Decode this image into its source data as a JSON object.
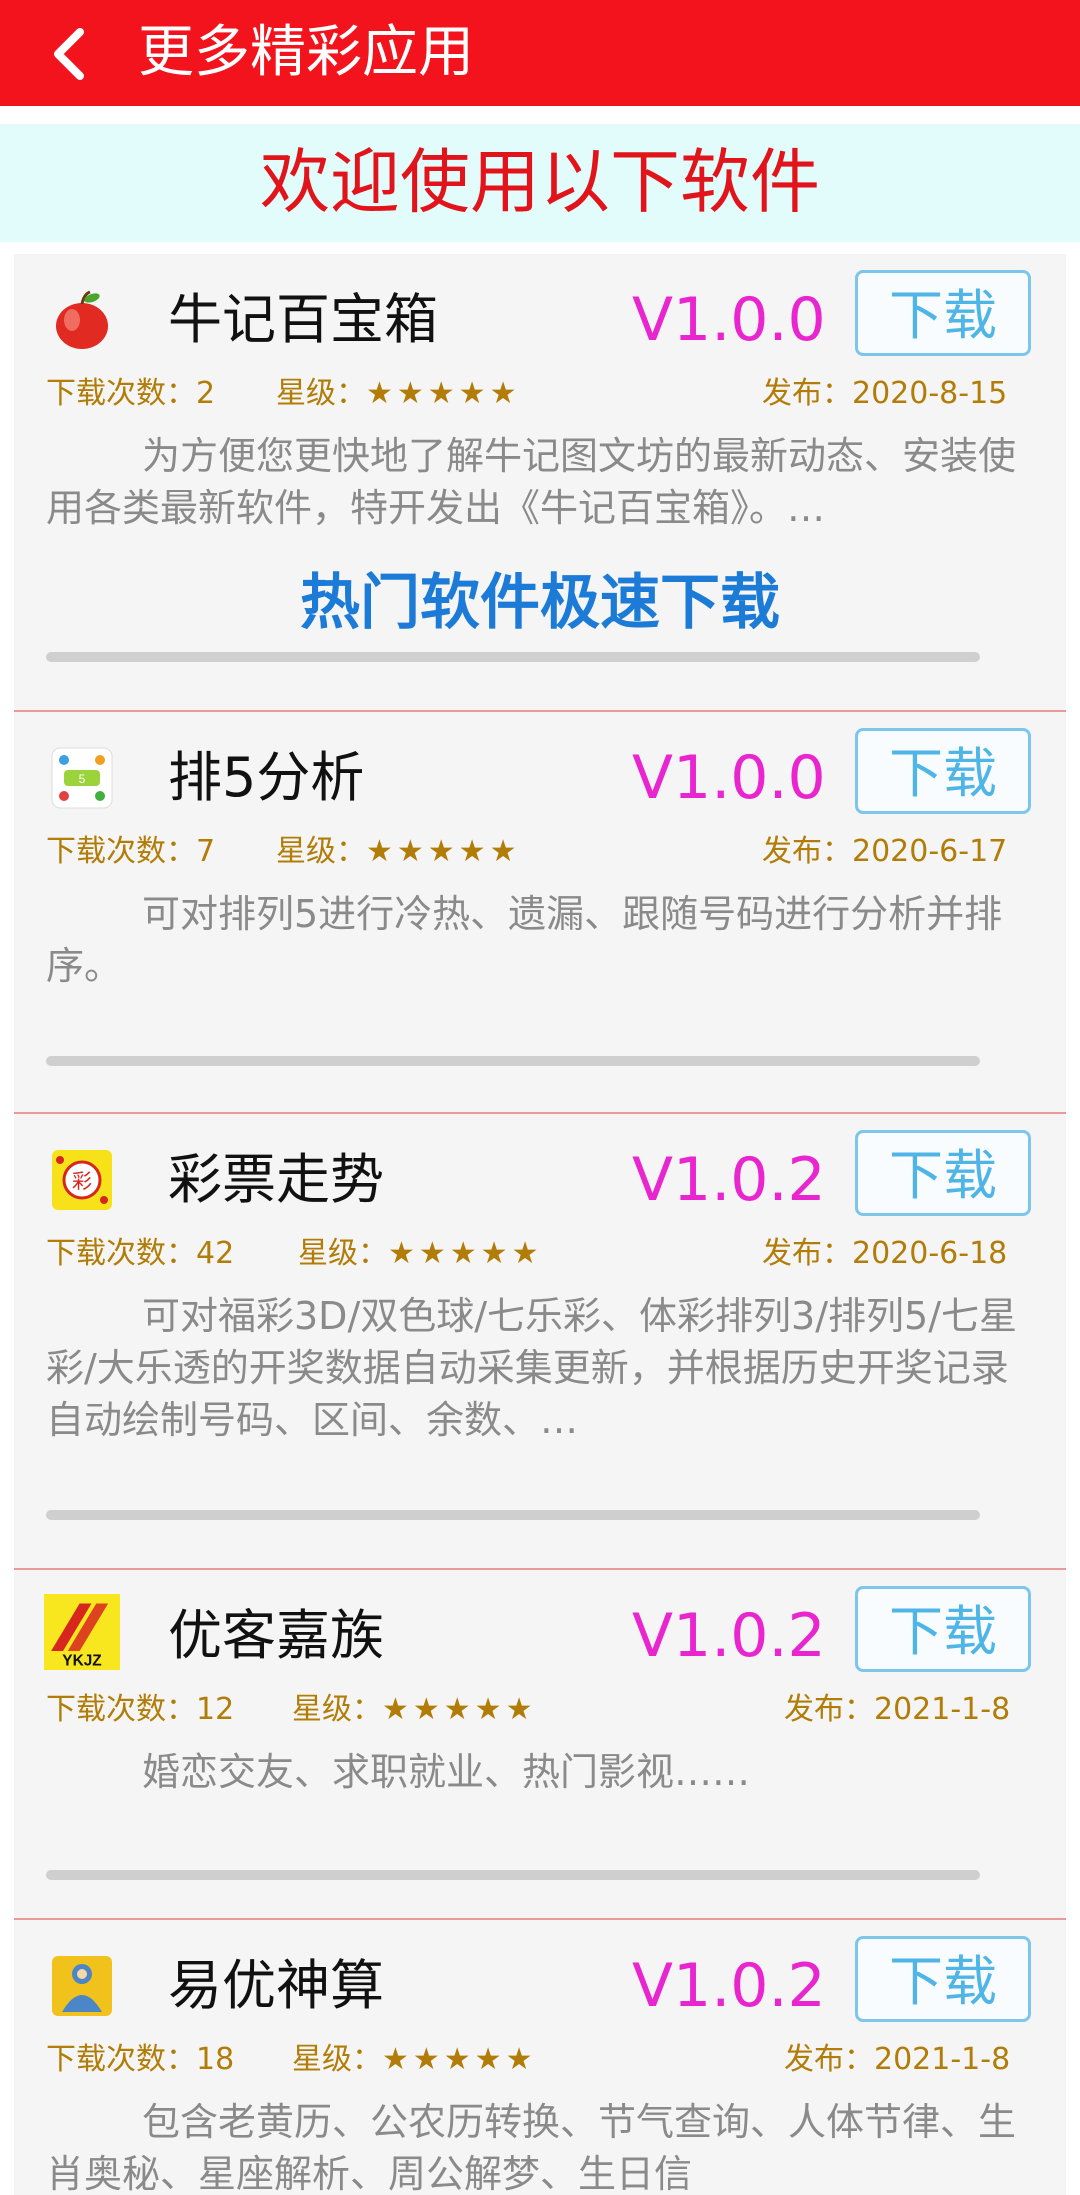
{
  "header": {
    "title": "更多精彩应用"
  },
  "banner": {
    "title": "欢迎使用以下软件"
  },
  "overlay": {
    "text": "热门软件极速下载"
  },
  "labels": {
    "download_button": "下载",
    "downloads_prefix": "下载次数：",
    "rating_prefix": "星级：",
    "release_prefix": "发布："
  },
  "apps": [
    {
      "name": "牛记百宝箱",
      "icon": "apple-icon",
      "version": "V1.0.0",
      "downloads": "2",
      "rating": "★★★★★",
      "release": "2020-8-15",
      "description": "为方便您更快地了解牛记图文坊的最新动态、安装使用各类最新软件，特开发出《牛记百宝箱》。…"
    },
    {
      "name": "排5分析",
      "icon": "pai5-icon",
      "version": "V1.0.0",
      "downloads": "7",
      "rating": "★★★★★",
      "release": "2020-6-17",
      "description": "可对排列5进行冷热、遗漏、跟随号码进行分析并排序。"
    },
    {
      "name": "彩票走势",
      "icon": "lottery-icon",
      "version": "V1.0.2",
      "downloads": "42",
      "rating": "★★★★★",
      "release": "2020-6-18",
      "description": "可对福彩3D/双色球/七乐彩、体彩排列3/排列5/七星彩/大乐透的开奖数据自动采集更新，并根据历史开奖记录自动绘制号码、区间、余数、…"
    },
    {
      "name": "优客嘉族",
      "icon": "ykjz-logo-icon",
      "version": "V1.0.2",
      "downloads": "12",
      "rating": "★★★★★",
      "release": "2021-1-8",
      "description": "婚恋交友、求职就业、热门影视……"
    },
    {
      "name": "易优神算",
      "icon": "fortune-teller-icon",
      "version": "V1.0.2",
      "downloads": "18",
      "rating": "★★★★★",
      "release": "2021-1-8",
      "description": "包含老黄历、公农历转换、节气查询、人体节律、生肖奥秘、星座解析、周公解梦、生日信"
    }
  ]
}
